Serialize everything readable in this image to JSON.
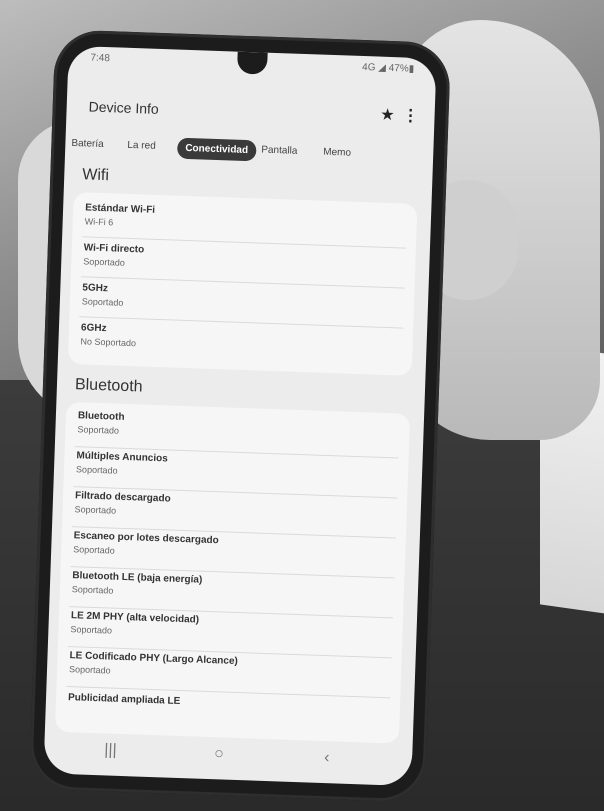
{
  "status_bar": {
    "time": "7:48",
    "indicators": "4G ◢ 47%▮"
  },
  "app": {
    "title": "Device Info",
    "star_icon": "star-icon",
    "menu_icon": "more-vert-icon"
  },
  "tabs": [
    {
      "label": "Batería",
      "active": false
    },
    {
      "label": "La red",
      "active": false
    },
    {
      "label": "Conectividad",
      "active": true
    },
    {
      "label": "Pantalla",
      "active": false
    },
    {
      "label": "Memo",
      "active": false
    }
  ],
  "wifi": {
    "title": "Wifi",
    "items": [
      {
        "label": "Estándar Wi-Fi",
        "value": "Wi-Fi 6"
      },
      {
        "label": "Wi-Fi directo",
        "value": "Soportado"
      },
      {
        "label": "5GHz",
        "value": "Soportado"
      },
      {
        "label": "6GHz",
        "value": "No Soportado"
      }
    ]
  },
  "bluetooth": {
    "title": "Bluetooth",
    "items": [
      {
        "label": "Bluetooth",
        "value": "Soportado"
      },
      {
        "label": "Múltiples Anuncios",
        "value": "Soportado"
      },
      {
        "label": "Filtrado descargado",
        "value": "Soportado"
      },
      {
        "label": "Escaneo por lotes descargado",
        "value": "Soportado"
      },
      {
        "label": "Bluetooth LE (baja energía)",
        "value": "Soportado"
      },
      {
        "label": "LE 2M PHY (alta velocidad)",
        "value": "Soportado"
      },
      {
        "label": "LE Codificado PHY (Largo Alcance)",
        "value": "Soportado"
      },
      {
        "label": "Publicidad ampliada LE",
        "value": ""
      }
    ]
  },
  "navbar": {
    "recents": "|||",
    "home": "○",
    "back": "‹"
  }
}
